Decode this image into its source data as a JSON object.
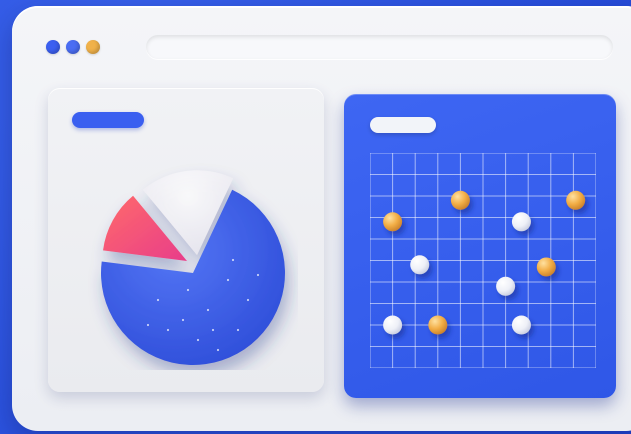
{
  "window": {
    "traffic_lights": [
      {
        "name": "blue-dot",
        "color": "#3b5ff0"
      },
      {
        "name": "blue-dot",
        "color": "#4a6df3"
      },
      {
        "name": "orange-dot",
        "color": "#f0b14a"
      }
    ],
    "address_bar_text": ""
  },
  "left_card": {
    "title_pill_color": "#3a5ff0",
    "pie": {
      "slices": [
        {
          "name": "blue-slice",
          "value": 0.7,
          "color": "#3558e8"
        },
        {
          "name": "pink-slice",
          "value": 0.12,
          "color": "#f24a76"
        },
        {
          "name": "white-slice",
          "value": 0.18,
          "color": "#f3f2f7"
        }
      ]
    }
  },
  "right_card": {
    "bg_color": "#3a62f0",
    "title_pill_color": "#f2f4f9",
    "grid": {
      "cols": 10,
      "rows": 10,
      "line_color": "rgba(255,255,255,0.55)"
    },
    "points": [
      {
        "x": 0.1,
        "y": 0.68,
        "kind": "orange"
      },
      {
        "x": 0.4,
        "y": 0.78,
        "kind": "orange"
      },
      {
        "x": 0.91,
        "y": 0.78,
        "kind": "orange"
      },
      {
        "x": 0.78,
        "y": 0.47,
        "kind": "orange"
      },
      {
        "x": 0.3,
        "y": 0.2,
        "kind": "orange"
      },
      {
        "x": 0.22,
        "y": 0.48,
        "kind": "white"
      },
      {
        "x": 0.67,
        "y": 0.68,
        "kind": "white"
      },
      {
        "x": 0.6,
        "y": 0.38,
        "kind": "white"
      },
      {
        "x": 0.1,
        "y": 0.2,
        "kind": "white"
      },
      {
        "x": 0.67,
        "y": 0.2,
        "kind": "white"
      }
    ]
  }
}
